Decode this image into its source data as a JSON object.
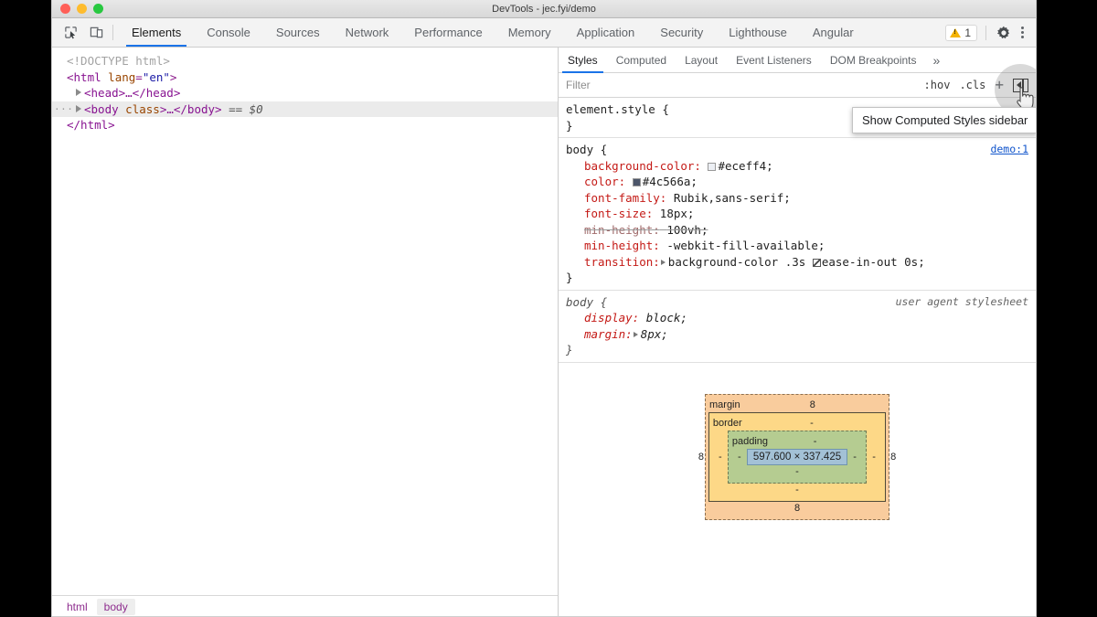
{
  "window": {
    "title": "DevTools - jec.fyi/demo",
    "traffic_lights": [
      "close",
      "minimize",
      "zoom"
    ]
  },
  "toolbar": {
    "icons": [
      {
        "name": "inspect-element-icon",
        "label": "Inspect element"
      },
      {
        "name": "device-toolbar-icon",
        "label": "Toggle device toolbar"
      }
    ],
    "tabs": [
      {
        "label": "Elements",
        "active": true
      },
      {
        "label": "Console",
        "active": false
      },
      {
        "label": "Sources",
        "active": false
      },
      {
        "label": "Network",
        "active": false
      },
      {
        "label": "Performance",
        "active": false
      },
      {
        "label": "Memory",
        "active": false
      },
      {
        "label": "Application",
        "active": false
      },
      {
        "label": "Security",
        "active": false
      },
      {
        "label": "Lighthouse",
        "active": false
      },
      {
        "label": "Angular",
        "active": false
      }
    ],
    "warning_count": "1",
    "settings_icon": "gear-icon",
    "more_icon": "kebab-menu-icon"
  },
  "dom_tree": {
    "rows": [
      {
        "doctype": "<!DOCTYPE html>"
      },
      {
        "open_html": "<html lang=\"en\">"
      },
      {
        "head": "<head>…</head>"
      },
      {
        "body_open": "<body",
        "body_attr": "class",
        "body_rest": ">…</body>",
        "body_marker": "== $0"
      },
      {
        "close_html": "</html>"
      }
    ],
    "gutter_dots": "···"
  },
  "breadcrumb": {
    "items": [
      {
        "label": "html",
        "active": false
      },
      {
        "label": "body",
        "active": true
      }
    ]
  },
  "styles": {
    "tabs": [
      {
        "label": "Styles",
        "active": true
      },
      {
        "label": "Computed",
        "active": false
      },
      {
        "label": "Layout",
        "active": false
      },
      {
        "label": "Event Listeners",
        "active": false
      },
      {
        "label": "DOM Breakpoints",
        "active": false
      }
    ],
    "more_tabs_chevron": "»",
    "filter_placeholder": "Filter",
    "filter_value": "",
    "actions": {
      "hov": ":hov",
      "cls": ".cls",
      "new_rule": "+",
      "sidebar_toggle": "show-computed-styles-sidebar"
    },
    "rules": [
      {
        "selector": "element.style {",
        "close": "}",
        "origin": "",
        "origin_type": "none",
        "declarations": []
      },
      {
        "selector": "body {",
        "close": "}",
        "origin": "demo:1",
        "origin_type": "link",
        "declarations": [
          {
            "prop": "background-color:",
            "value": "#eceff4;",
            "swatch": "#eceff4",
            "overridden": false
          },
          {
            "prop": "color:",
            "value": "#4c566a;",
            "swatch": "#4c566a",
            "overridden": false
          },
          {
            "prop": "font-family:",
            "value": "Rubik,sans-serif;",
            "overridden": false
          },
          {
            "prop": "font-size:",
            "value": "18px;",
            "overridden": false
          },
          {
            "prop": "min-height:",
            "value": "100vh;",
            "overridden": true
          },
          {
            "prop": "min-height:",
            "value": "-webkit-fill-available;",
            "overridden": false
          },
          {
            "prop": "transition:",
            "value": "background-color .3s ease-in-out 0s;",
            "expandable": true,
            "bezier": true,
            "overridden": false
          }
        ]
      },
      {
        "selector": "body {",
        "close": "}",
        "origin": "user agent stylesheet",
        "origin_type": "ua",
        "user_agent": true,
        "declarations": [
          {
            "prop": "display:",
            "value": "block;",
            "overridden": false
          },
          {
            "prop": "margin:",
            "value": "8px;",
            "expandable": true,
            "overridden": false
          }
        ]
      }
    ]
  },
  "box_model": {
    "margin_label": "margin",
    "margin_top": "8",
    "margin_right": "8",
    "margin_bottom": "8",
    "margin_left": "8",
    "border_label": "border",
    "border_top": "-",
    "border_right": "-",
    "border_bottom": "-",
    "border_left": "-",
    "padding_label": "padding",
    "padding_top": "-",
    "padding_right": "-",
    "padding_bottom": "-",
    "padding_left": "-",
    "content_size": "597.600 × 337.425",
    "colors": {
      "margin": "#f9cc9d",
      "border": "#fdd887",
      "padding": "#b5cc91",
      "content": "#a3c1d6"
    }
  },
  "tooltip": {
    "text": "Show Computed Styles sidebar"
  }
}
